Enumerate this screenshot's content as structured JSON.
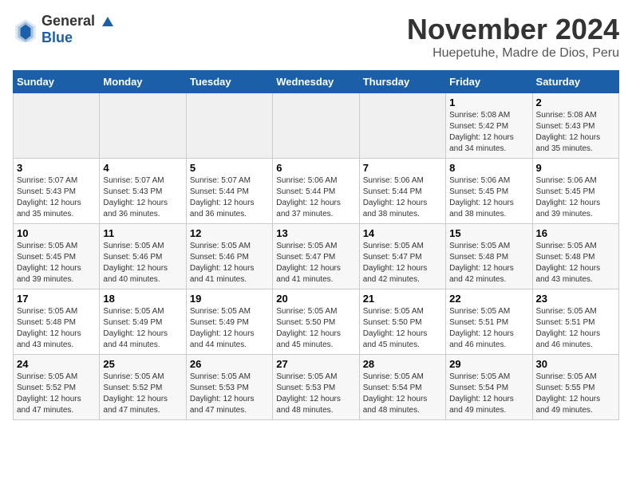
{
  "logo": {
    "general": "General",
    "blue": "Blue"
  },
  "header": {
    "title": "November 2024",
    "subtitle": "Huepetuhe, Madre de Dios, Peru"
  },
  "weekdays": [
    "Sunday",
    "Monday",
    "Tuesday",
    "Wednesday",
    "Thursday",
    "Friday",
    "Saturday"
  ],
  "weeks": [
    [
      {
        "day": "",
        "sunrise": "",
        "sunset": "",
        "daylight": ""
      },
      {
        "day": "",
        "sunrise": "",
        "sunset": "",
        "daylight": ""
      },
      {
        "day": "",
        "sunrise": "",
        "sunset": "",
        "daylight": ""
      },
      {
        "day": "",
        "sunrise": "",
        "sunset": "",
        "daylight": ""
      },
      {
        "day": "",
        "sunrise": "",
        "sunset": "",
        "daylight": ""
      },
      {
        "day": "1",
        "sunrise": "Sunrise: 5:08 AM",
        "sunset": "Sunset: 5:42 PM",
        "daylight": "Daylight: 12 hours and 34 minutes."
      },
      {
        "day": "2",
        "sunrise": "Sunrise: 5:08 AM",
        "sunset": "Sunset: 5:43 PM",
        "daylight": "Daylight: 12 hours and 35 minutes."
      }
    ],
    [
      {
        "day": "3",
        "sunrise": "Sunrise: 5:07 AM",
        "sunset": "Sunset: 5:43 PM",
        "daylight": "Daylight: 12 hours and 35 minutes."
      },
      {
        "day": "4",
        "sunrise": "Sunrise: 5:07 AM",
        "sunset": "Sunset: 5:43 PM",
        "daylight": "Daylight: 12 hours and 36 minutes."
      },
      {
        "day": "5",
        "sunrise": "Sunrise: 5:07 AM",
        "sunset": "Sunset: 5:44 PM",
        "daylight": "Daylight: 12 hours and 36 minutes."
      },
      {
        "day": "6",
        "sunrise": "Sunrise: 5:06 AM",
        "sunset": "Sunset: 5:44 PM",
        "daylight": "Daylight: 12 hours and 37 minutes."
      },
      {
        "day": "7",
        "sunrise": "Sunrise: 5:06 AM",
        "sunset": "Sunset: 5:44 PM",
        "daylight": "Daylight: 12 hours and 38 minutes."
      },
      {
        "day": "8",
        "sunrise": "Sunrise: 5:06 AM",
        "sunset": "Sunset: 5:45 PM",
        "daylight": "Daylight: 12 hours and 38 minutes."
      },
      {
        "day": "9",
        "sunrise": "Sunrise: 5:06 AM",
        "sunset": "Sunset: 5:45 PM",
        "daylight": "Daylight: 12 hours and 39 minutes."
      }
    ],
    [
      {
        "day": "10",
        "sunrise": "Sunrise: 5:05 AM",
        "sunset": "Sunset: 5:45 PM",
        "daylight": "Daylight: 12 hours and 39 minutes."
      },
      {
        "day": "11",
        "sunrise": "Sunrise: 5:05 AM",
        "sunset": "Sunset: 5:46 PM",
        "daylight": "Daylight: 12 hours and 40 minutes."
      },
      {
        "day": "12",
        "sunrise": "Sunrise: 5:05 AM",
        "sunset": "Sunset: 5:46 PM",
        "daylight": "Daylight: 12 hours and 41 minutes."
      },
      {
        "day": "13",
        "sunrise": "Sunrise: 5:05 AM",
        "sunset": "Sunset: 5:47 PM",
        "daylight": "Daylight: 12 hours and 41 minutes."
      },
      {
        "day": "14",
        "sunrise": "Sunrise: 5:05 AM",
        "sunset": "Sunset: 5:47 PM",
        "daylight": "Daylight: 12 hours and 42 minutes."
      },
      {
        "day": "15",
        "sunrise": "Sunrise: 5:05 AM",
        "sunset": "Sunset: 5:48 PM",
        "daylight": "Daylight: 12 hours and 42 minutes."
      },
      {
        "day": "16",
        "sunrise": "Sunrise: 5:05 AM",
        "sunset": "Sunset: 5:48 PM",
        "daylight": "Daylight: 12 hours and 43 minutes."
      }
    ],
    [
      {
        "day": "17",
        "sunrise": "Sunrise: 5:05 AM",
        "sunset": "Sunset: 5:48 PM",
        "daylight": "Daylight: 12 hours and 43 minutes."
      },
      {
        "day": "18",
        "sunrise": "Sunrise: 5:05 AM",
        "sunset": "Sunset: 5:49 PM",
        "daylight": "Daylight: 12 hours and 44 minutes."
      },
      {
        "day": "19",
        "sunrise": "Sunrise: 5:05 AM",
        "sunset": "Sunset: 5:49 PM",
        "daylight": "Daylight: 12 hours and 44 minutes."
      },
      {
        "day": "20",
        "sunrise": "Sunrise: 5:05 AM",
        "sunset": "Sunset: 5:50 PM",
        "daylight": "Daylight: 12 hours and 45 minutes."
      },
      {
        "day": "21",
        "sunrise": "Sunrise: 5:05 AM",
        "sunset": "Sunset: 5:50 PM",
        "daylight": "Daylight: 12 hours and 45 minutes."
      },
      {
        "day": "22",
        "sunrise": "Sunrise: 5:05 AM",
        "sunset": "Sunset: 5:51 PM",
        "daylight": "Daylight: 12 hours and 46 minutes."
      },
      {
        "day": "23",
        "sunrise": "Sunrise: 5:05 AM",
        "sunset": "Sunset: 5:51 PM",
        "daylight": "Daylight: 12 hours and 46 minutes."
      }
    ],
    [
      {
        "day": "24",
        "sunrise": "Sunrise: 5:05 AM",
        "sunset": "Sunset: 5:52 PM",
        "daylight": "Daylight: 12 hours and 47 minutes."
      },
      {
        "day": "25",
        "sunrise": "Sunrise: 5:05 AM",
        "sunset": "Sunset: 5:52 PM",
        "daylight": "Daylight: 12 hours and 47 minutes."
      },
      {
        "day": "26",
        "sunrise": "Sunrise: 5:05 AM",
        "sunset": "Sunset: 5:53 PM",
        "daylight": "Daylight: 12 hours and 47 minutes."
      },
      {
        "day": "27",
        "sunrise": "Sunrise: 5:05 AM",
        "sunset": "Sunset: 5:53 PM",
        "daylight": "Daylight: 12 hours and 48 minutes."
      },
      {
        "day": "28",
        "sunrise": "Sunrise: 5:05 AM",
        "sunset": "Sunset: 5:54 PM",
        "daylight": "Daylight: 12 hours and 48 minutes."
      },
      {
        "day": "29",
        "sunrise": "Sunrise: 5:05 AM",
        "sunset": "Sunset: 5:54 PM",
        "daylight": "Daylight: 12 hours and 49 minutes."
      },
      {
        "day": "30",
        "sunrise": "Sunrise: 5:05 AM",
        "sunset": "Sunset: 5:55 PM",
        "daylight": "Daylight: 12 hours and 49 minutes."
      }
    ]
  ]
}
